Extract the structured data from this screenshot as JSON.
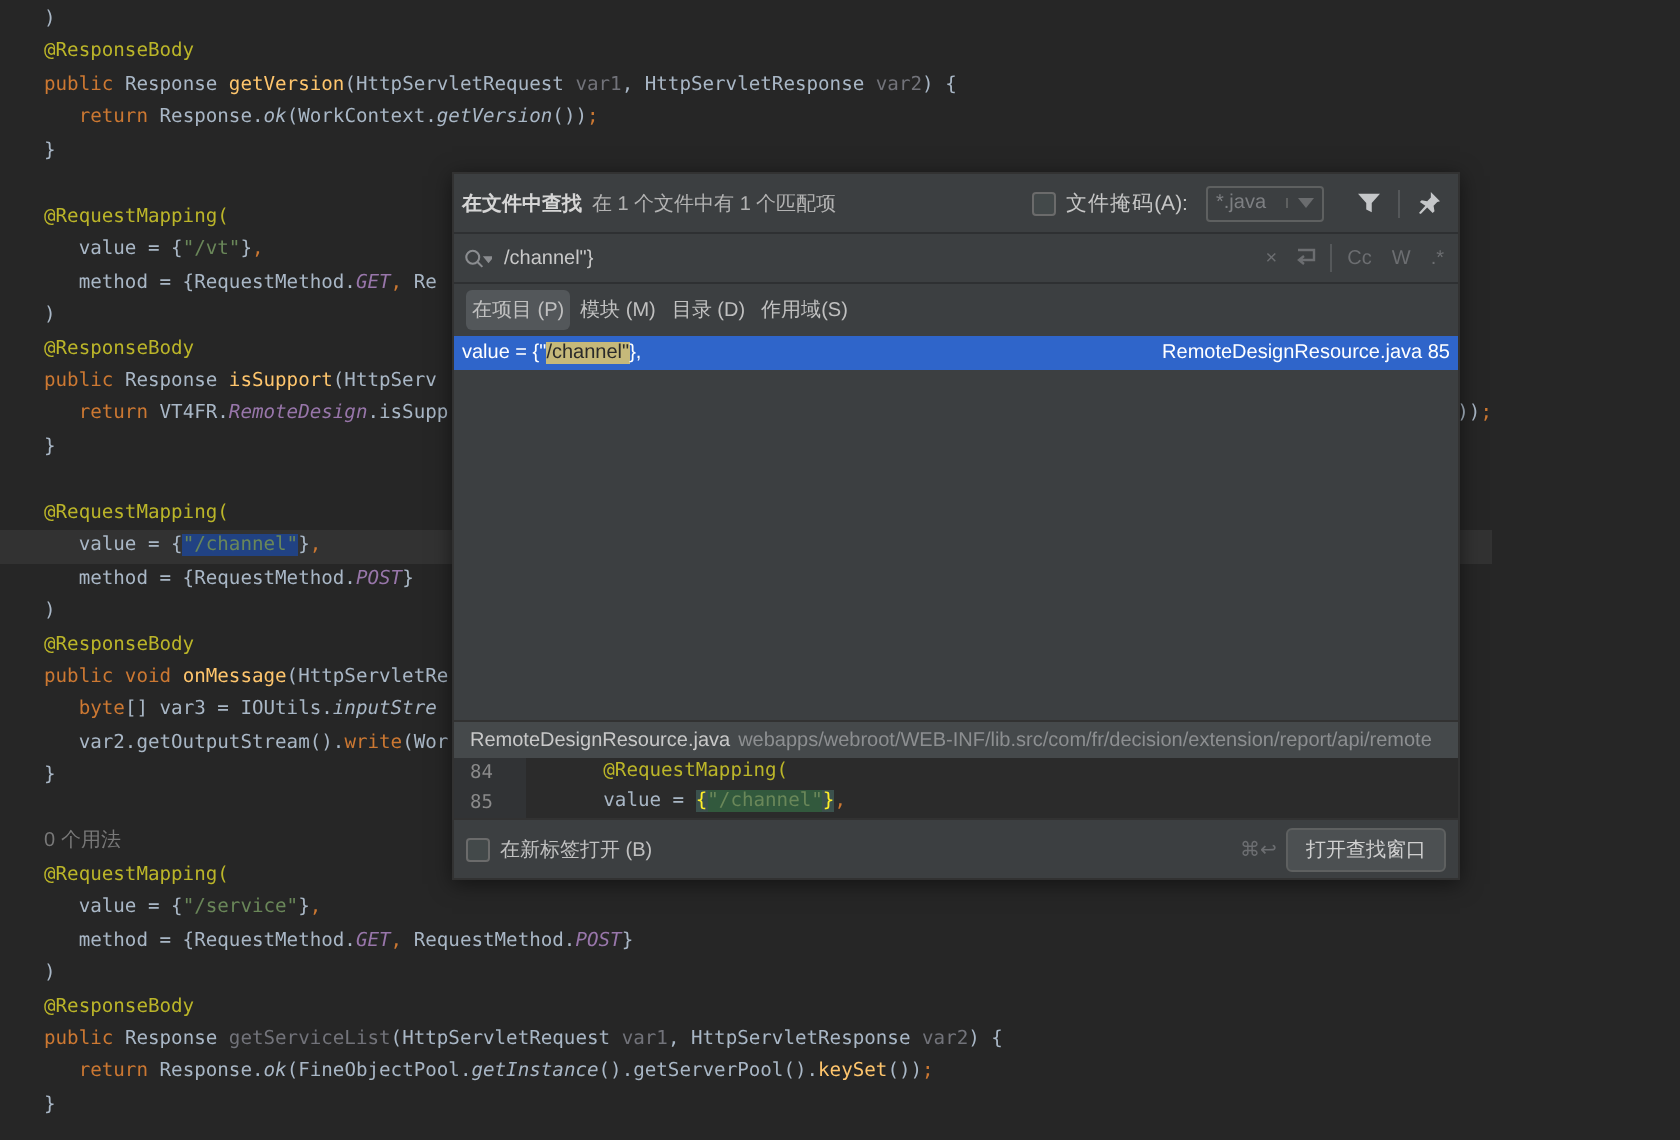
{
  "editor": {
    "lines": [
      {
        "tokens": [
          {
            "kind": "p",
            "text": ")"
          }
        ]
      },
      {
        "tokens": [
          {
            "kind": "ann",
            "text": "@ResponseBody"
          }
        ]
      },
      {
        "tokens": [
          {
            "kind": "kw",
            "text": "public "
          },
          {
            "kind": "p",
            "text": "Response "
          },
          {
            "kind": "fn",
            "text": "getVersion"
          },
          {
            "kind": "p",
            "text": "(HttpServletRequest "
          },
          {
            "kind": "u",
            "text": "var1"
          },
          {
            "kind": "p",
            "text": ", HttpServletResponse "
          },
          {
            "kind": "u",
            "text": "var2"
          },
          {
            "kind": "p",
            "text": ") {"
          }
        ]
      },
      {
        "tokens": [
          {
            "kind": "kw",
            "text": "   return "
          },
          {
            "kind": "p",
            "text": "Response."
          },
          {
            "kind": "it",
            "text": "ok"
          },
          {
            "kind": "p",
            "text": "(WorkContext."
          },
          {
            "kind": "it",
            "text": "getVersion"
          },
          {
            "kind": "p",
            "text": "())"
          },
          {
            "kind": "kw",
            "text": ";"
          }
        ]
      },
      {
        "tokens": [
          {
            "kind": "p",
            "text": "}"
          }
        ]
      },
      {
        "tokens": [
          {
            "kind": "ann",
            "text": "@RequestMapping("
          }
        ],
        "blank_before": true
      },
      {
        "tokens": [
          {
            "kind": "p",
            "text": "   value = {"
          },
          {
            "kind": "str",
            "text": "\"/vt\""
          },
          {
            "kind": "p",
            "text": "}"
          },
          {
            "kind": "kw",
            "text": ","
          }
        ]
      },
      {
        "tokens": [
          {
            "kind": "p",
            "text": "   method = {RequestMethod."
          },
          {
            "kind": "st",
            "text": "GET"
          },
          {
            "kind": "kw",
            "text": ", "
          },
          {
            "kind": "p",
            "text": "Re"
          }
        ]
      },
      {
        "tokens": [
          {
            "kind": "p",
            "text": ")"
          }
        ]
      },
      {
        "tokens": [
          {
            "kind": "ann",
            "text": "@ResponseBody"
          }
        ]
      },
      {
        "tokens": [
          {
            "kind": "kw",
            "text": "public "
          },
          {
            "kind": "p",
            "text": "Response "
          },
          {
            "kind": "fn",
            "text": "isSupport"
          },
          {
            "kind": "p",
            "text": "(HttpServ"
          }
        ]
      },
      {
        "tokens": [
          {
            "kind": "kw",
            "text": "   return "
          },
          {
            "kind": "p",
            "text": "VT4FR."
          },
          {
            "kind": "st",
            "text": "RemoteDesign"
          },
          {
            "kind": "p",
            "text": ".isSupp"
          }
        ],
        "tail": [
          {
            "kind": "p",
            "text": "))"
          },
          {
            "kind": "kw",
            "text": ";"
          }
        ]
      },
      {
        "tokens": [
          {
            "kind": "p",
            "text": "}"
          }
        ]
      },
      {
        "tokens": [
          {
            "kind": "ann",
            "text": "@RequestMapping("
          }
        ],
        "blank_before": true
      },
      {
        "tokens": [
          {
            "kind": "p",
            "text": "   value = {"
          },
          {
            "kind": "sel",
            "text": "\"/channel\""
          },
          {
            "kind": "p",
            "text": "}"
          },
          {
            "kind": "kw",
            "text": ","
          }
        ],
        "current": true
      },
      {
        "tokens": [
          {
            "kind": "p",
            "text": "   method = {RequestMethod."
          },
          {
            "kind": "st",
            "text": "POST"
          },
          {
            "kind": "p",
            "text": "}"
          }
        ]
      },
      {
        "tokens": [
          {
            "kind": "p",
            "text": ")"
          }
        ]
      },
      {
        "tokens": [
          {
            "kind": "ann",
            "text": "@ResponseBody"
          }
        ]
      },
      {
        "tokens": [
          {
            "kind": "kw",
            "text": "public void "
          },
          {
            "kind": "fn",
            "text": "onMessage"
          },
          {
            "kind": "p",
            "text": "(HttpServletRe"
          }
        ]
      },
      {
        "tokens": [
          {
            "kind": "kw",
            "text": "   byte"
          },
          {
            "kind": "p",
            "text": "[] var3 = IOUtils."
          },
          {
            "kind": "it",
            "text": "inputStre"
          }
        ]
      },
      {
        "tokens": [
          {
            "kind": "p",
            "text": "   var2.getOutputStream()."
          },
          {
            "kind": "kw",
            "text": "write"
          },
          {
            "kind": "p",
            "text": "(Wor"
          }
        ]
      },
      {
        "tokens": [
          {
            "kind": "p",
            "text": "}"
          }
        ]
      },
      {
        "tokens": [
          {
            "kind": "hint",
            "text": "0 个用法"
          }
        ],
        "blank_before": true
      },
      {
        "tokens": [
          {
            "kind": "ann",
            "text": "@RequestMapping("
          }
        ]
      },
      {
        "tokens": [
          {
            "kind": "p",
            "text": "   value = {"
          },
          {
            "kind": "str",
            "text": "\"/service\""
          },
          {
            "kind": "p",
            "text": "}"
          },
          {
            "kind": "kw",
            "text": ","
          }
        ]
      },
      {
        "tokens": [
          {
            "kind": "p",
            "text": "   method = {RequestMethod."
          },
          {
            "kind": "st",
            "text": "GET"
          },
          {
            "kind": "kw",
            "text": ", "
          },
          {
            "kind": "p",
            "text": "RequestMethod."
          },
          {
            "kind": "st",
            "text": "POST"
          },
          {
            "kind": "p",
            "text": "}"
          }
        ]
      },
      {
        "tokens": [
          {
            "kind": "p",
            "text": ")"
          }
        ]
      },
      {
        "tokens": [
          {
            "kind": "ann",
            "text": "@ResponseBody"
          }
        ]
      },
      {
        "tokens": [
          {
            "kind": "kw",
            "text": "public "
          },
          {
            "kind": "p",
            "text": "Response "
          },
          {
            "kind": "u",
            "text": "getServiceList"
          },
          {
            "kind": "p",
            "text": "(HttpServletRequest "
          },
          {
            "kind": "u",
            "text": "var1"
          },
          {
            "kind": "p",
            "text": ", HttpServletResponse "
          },
          {
            "kind": "u",
            "text": "var2"
          },
          {
            "kind": "p",
            "text": ") {"
          }
        ]
      },
      {
        "tokens": [
          {
            "kind": "kw",
            "text": "   return "
          },
          {
            "kind": "p",
            "text": "Response."
          },
          {
            "kind": "it",
            "text": "ok"
          },
          {
            "kind": "p",
            "text": "(FineObjectPool."
          },
          {
            "kind": "it",
            "text": "getInstance"
          },
          {
            "kind": "p",
            "text": "().getServerPool()."
          },
          {
            "kind": "fn",
            "text": "keySet"
          },
          {
            "kind": "p",
            "text": "())"
          },
          {
            "kind": "kw",
            "text": ";"
          }
        ]
      },
      {
        "tokens": [
          {
            "kind": "p",
            "text": "}"
          }
        ]
      }
    ]
  },
  "find_popup": {
    "title": "在文件中查找",
    "summary": "在 1 个文件中有 1 个匹配项",
    "file_mask": {
      "label": "文件掩码(A):",
      "checked": false,
      "value": "*.java"
    },
    "search": {
      "value": "/channel\"}",
      "clear": "×",
      "toggles": [
        "Cc",
        "W",
        ".*"
      ]
    },
    "scopes": [
      {
        "label": "在项目 (P)",
        "selected": true
      },
      {
        "label": "模块 (M)",
        "selected": false
      },
      {
        "label": "目录 (D)",
        "selected": false
      },
      {
        "label": "作用域(S)",
        "selected": false
      }
    ],
    "results": [
      {
        "before": "value = {\"",
        "match": "/channel\"",
        "after": "},",
        "location": "RemoteDesignResource.java 85",
        "selected": true
      }
    ],
    "preview": {
      "file": "RemoteDesignResource.java",
      "path": "webapps/webroot/WEB-INF/lib.src/com/fr/decision/extension/report/api/remote",
      "lines": [
        {
          "number": "84",
          "tokens": [
            {
              "kind": "ann",
              "text": "      @RequestMapping("
            }
          ]
        },
        {
          "number": "85",
          "tokens": [
            {
              "kind": "p",
              "text": "      value = "
            },
            {
              "kind": "brace",
              "text": "{"
            },
            {
              "kind": "hl",
              "text": "\"/channel\""
            },
            {
              "kind": "brace",
              "text": "}"
            },
            {
              "kind": "kw",
              "text": ","
            }
          ]
        }
      ]
    },
    "new_tab": {
      "label": "在新标签打开 (B)",
      "checked": false
    },
    "shortcut": "⌘↩",
    "open_button": "打开查找窗口"
  }
}
